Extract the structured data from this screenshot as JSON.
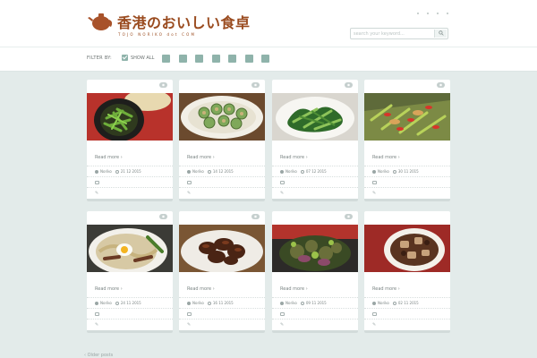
{
  "site": {
    "logo_text": "香港のおいしい食卓",
    "logo_sub": "TOJO NORIKO dot COM"
  },
  "search": {
    "placeholder": "search your keyword..."
  },
  "filter": {
    "label": "FILTER BY:",
    "show_all": "SHOW ALL",
    "categories_count": 7
  },
  "posts": [
    {
      "read_more": "Read more ›",
      "author": "Noriko",
      "date": "21 12 2015",
      "tag": "-"
    },
    {
      "read_more": "Read more ›",
      "author": "Noriko",
      "date": "14 12 2015",
      "tag": "-"
    },
    {
      "read_more": "Read more ›",
      "author": "Noriko",
      "date": "07 12 2015",
      "tag": "-"
    },
    {
      "read_more": "Read more ›",
      "author": "Noriko",
      "date": "30 11 2015",
      "tag": "-"
    },
    {
      "read_more": "Read more ›",
      "author": "Noriko",
      "date": "24 11 2015",
      "tag": "-"
    },
    {
      "read_more": "Read more ›",
      "author": "Noriko",
      "date": "16 11 2015",
      "tag": "-"
    },
    {
      "read_more": "Read more ›",
      "author": "Noriko",
      "date": "09 11 2015",
      "tag": "-"
    },
    {
      "read_more": "Read more ›",
      "author": "Noriko",
      "date": "02 11 2015",
      "tag": "-"
    }
  ],
  "pagination": {
    "older": "‹ Older posts"
  },
  "colors": {
    "accent": "#8fb3ab",
    "brand": "#9a4b1f",
    "background": "#e3ebea"
  }
}
